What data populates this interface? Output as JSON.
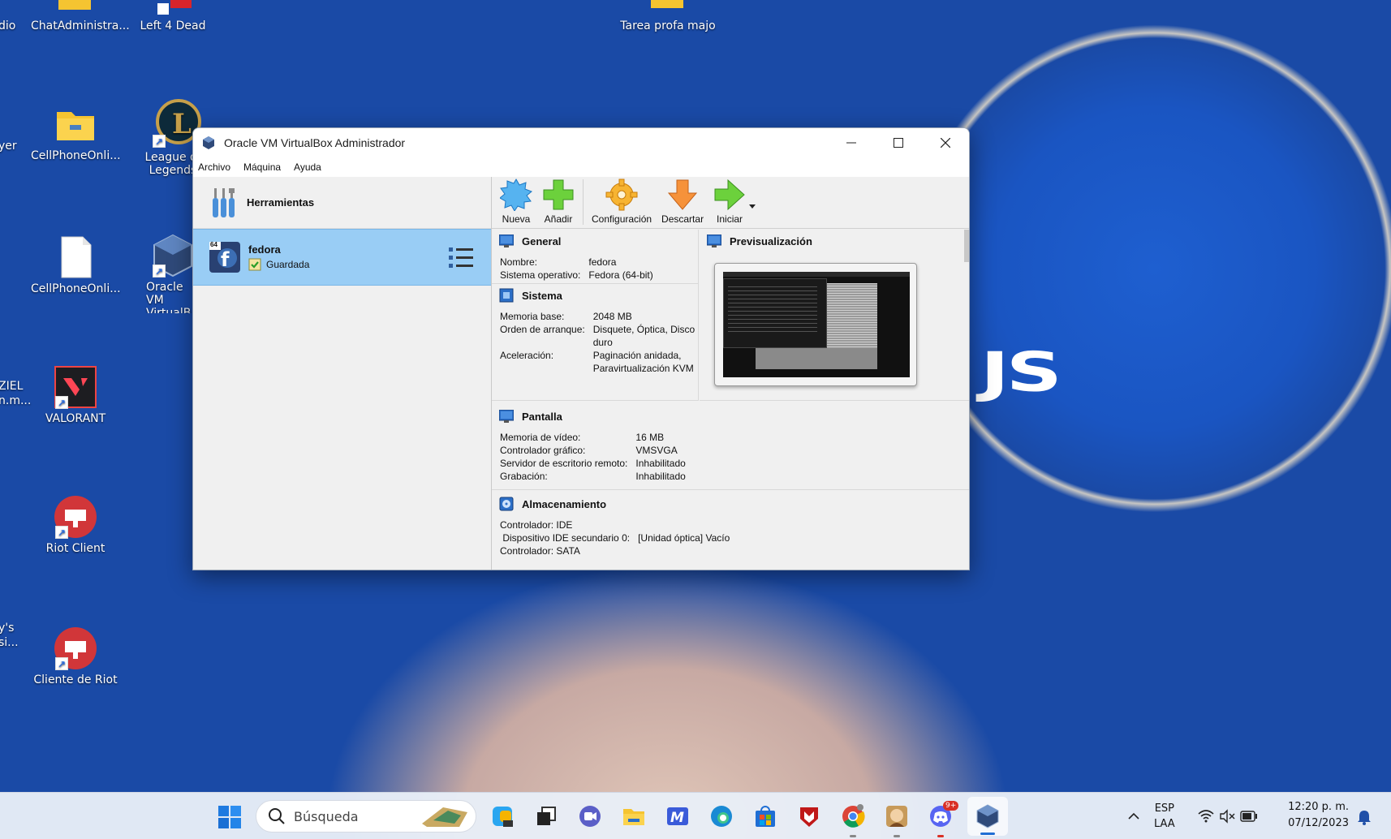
{
  "desktop": {
    "icons": [
      {
        "label": "ChatAdministra...",
        "icon": "folder-icon"
      },
      {
        "label": "Left 4 Dead",
        "icon": "game-icon"
      },
      {
        "label": "Tarea profa majo",
        "icon": "folder-icon"
      },
      {
        "label": "CellPhoneOnli...",
        "icon": "folder-icon"
      },
      {
        "label": "League of Legends",
        "icon": "league-icon"
      },
      {
        "label": "CellPhoneOnli...",
        "icon": "file-icon"
      },
      {
        "label": "Oracle VM VirtualBox",
        "icon": "virtualbox-icon"
      },
      {
        "label": "VALORANT",
        "icon": "valorant-icon"
      },
      {
        "label": "Riot Client",
        "icon": "riot-icon"
      },
      {
        "label": "Cliente de Riot",
        "icon": "riot-icon"
      }
    ],
    "partial_left": [
      "dio",
      "yer",
      "ZIEL",
      "n.m...",
      "y's",
      "si..."
    ],
    "brand_fragment": "JS"
  },
  "window": {
    "title": "Oracle VM VirtualBox Administrador",
    "menu": [
      "Archivo",
      "Máquina",
      "Ayuda"
    ],
    "tools_label": "Herramientas",
    "vm": {
      "name": "fedora",
      "state": "Guardada",
      "badge": "64"
    },
    "toolbar": [
      {
        "label": "Nueva",
        "icon": "new-icon"
      },
      {
        "label": "Añadir",
        "icon": "add-icon"
      },
      {
        "label": "Configuración",
        "icon": "settings-icon"
      },
      {
        "label": "Descartar",
        "icon": "discard-icon"
      },
      {
        "label": "Iniciar",
        "icon": "start-icon"
      }
    ],
    "general": {
      "title": "General",
      "rows": [
        [
          "Nombre:",
          "fedora"
        ],
        [
          "Sistema operativo:",
          "Fedora (64-bit)"
        ]
      ]
    },
    "sistema": {
      "title": "Sistema",
      "rows": [
        [
          "Memoria base:",
          "2048 MB"
        ],
        [
          "Orden de arranque:",
          "Disquete, Óptica, Disco duro"
        ],
        [
          "Aceleración:",
          "Paginación anidada, Paravirtualización KVM"
        ]
      ]
    },
    "preview": {
      "title": "Previsualización"
    },
    "pantalla": {
      "title": "Pantalla",
      "rows": [
        [
          "Memoria de vídeo:",
          "16 MB"
        ],
        [
          "Controlador gráfico:",
          "VMSVGA"
        ],
        [
          "Servidor de escritorio remoto:",
          "Inhabilitado"
        ],
        [
          "Grabación:",
          "Inhabilitado"
        ]
      ]
    },
    "almacenamiento": {
      "title": "Almacenamiento",
      "rows": [
        [
          "Controlador: IDE",
          ""
        ],
        [
          " Dispositivo IDE secundario 0:",
          "[Unidad óptica] Vacío"
        ],
        [
          "Controlador: SATA",
          ""
        ]
      ]
    }
  },
  "taskbar": {
    "search_placeholder": "Búsqueda",
    "lang": "ESP",
    "layout": "LAA",
    "time": "12:20 p. m.",
    "date": "07/12/2023",
    "badge": "9+"
  }
}
